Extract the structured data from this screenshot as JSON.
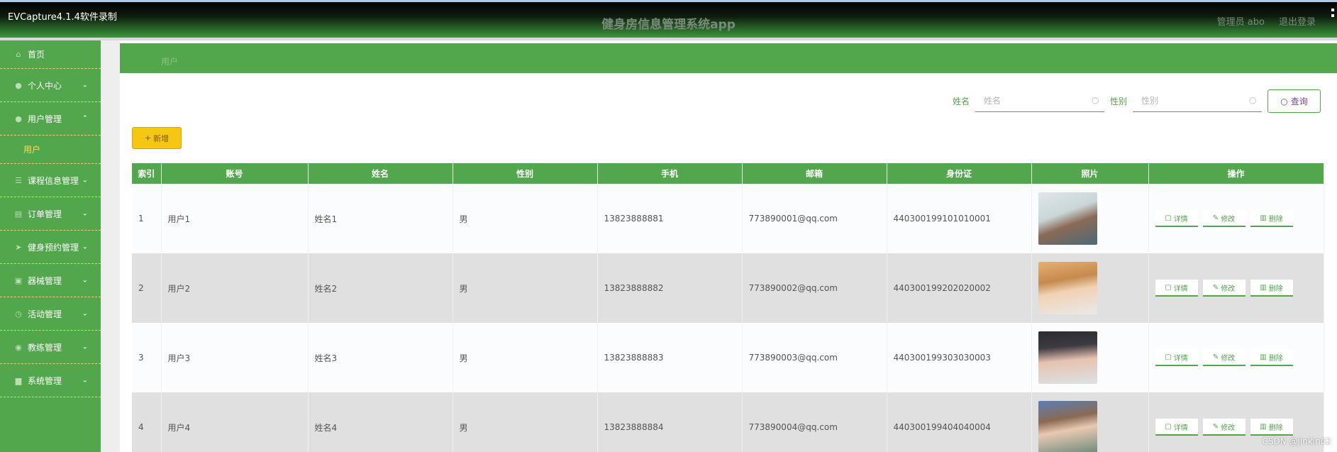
{
  "recorder_label": "EVCapture4.1.4软件录制",
  "app_title": "健身房信息管理系统app",
  "header": {
    "user_label": "管理员 abo",
    "logout_label": "退出登录"
  },
  "sidebar": {
    "items": [
      {
        "label": "首页",
        "icon": "home-icon"
      },
      {
        "label": "个人中心",
        "icon": "person-icon"
      },
      {
        "label": "用户管理",
        "icon": "person-icon",
        "expanded": true
      },
      {
        "label": "用户",
        "sub": true
      },
      {
        "label": "课程信息管理",
        "icon": "list-icon"
      },
      {
        "label": "订单管理",
        "icon": "order-icon"
      },
      {
        "label": "健身预约管理",
        "icon": "send-icon"
      },
      {
        "label": "器械管理",
        "icon": "tool-icon"
      },
      {
        "label": "活动管理",
        "icon": "activity-icon"
      },
      {
        "label": "教练管理",
        "icon": "coach-icon"
      },
      {
        "label": "系统管理",
        "icon": "system-icon"
      }
    ]
  },
  "breadcrumb": "用户",
  "search": {
    "name_label": "姓名",
    "name_placeholder": "姓名",
    "gender_label": "性别",
    "gender_placeholder": "性别",
    "query_label": "查询"
  },
  "add_label": "新增",
  "table": {
    "headers": [
      "索引",
      "账号",
      "姓名",
      "性别",
      "手机",
      "邮箱",
      "身份证",
      "照片",
      "操作"
    ],
    "rows": [
      {
        "index": "1",
        "account": "用户1",
        "name": "姓名1",
        "gender": "男",
        "phone": "13823888881",
        "email": "773890001@qq.com",
        "idcard": "440300199101010001"
      },
      {
        "index": "2",
        "account": "用户2",
        "name": "姓名2",
        "gender": "男",
        "phone": "13823888882",
        "email": "773890002@qq.com",
        "idcard": "440300199202020002"
      },
      {
        "index": "3",
        "account": "用户3",
        "name": "姓名3",
        "gender": "男",
        "phone": "13823888883",
        "email": "773890003@qq.com",
        "idcard": "440300199303030003"
      },
      {
        "index": "4",
        "account": "用户4",
        "name": "姓名4",
        "gender": "男",
        "phone": "13823888884",
        "email": "773890004@qq.com",
        "idcard": "440300199404040004"
      }
    ],
    "ops": {
      "detail": "详情",
      "edit": "修改",
      "delete": "删除"
    }
  },
  "watermark": "CSDN @jinkin02",
  "colors": {
    "primary": "#52a64c",
    "add_button": "#f6c712",
    "stripe": "#e1e0e1"
  }
}
